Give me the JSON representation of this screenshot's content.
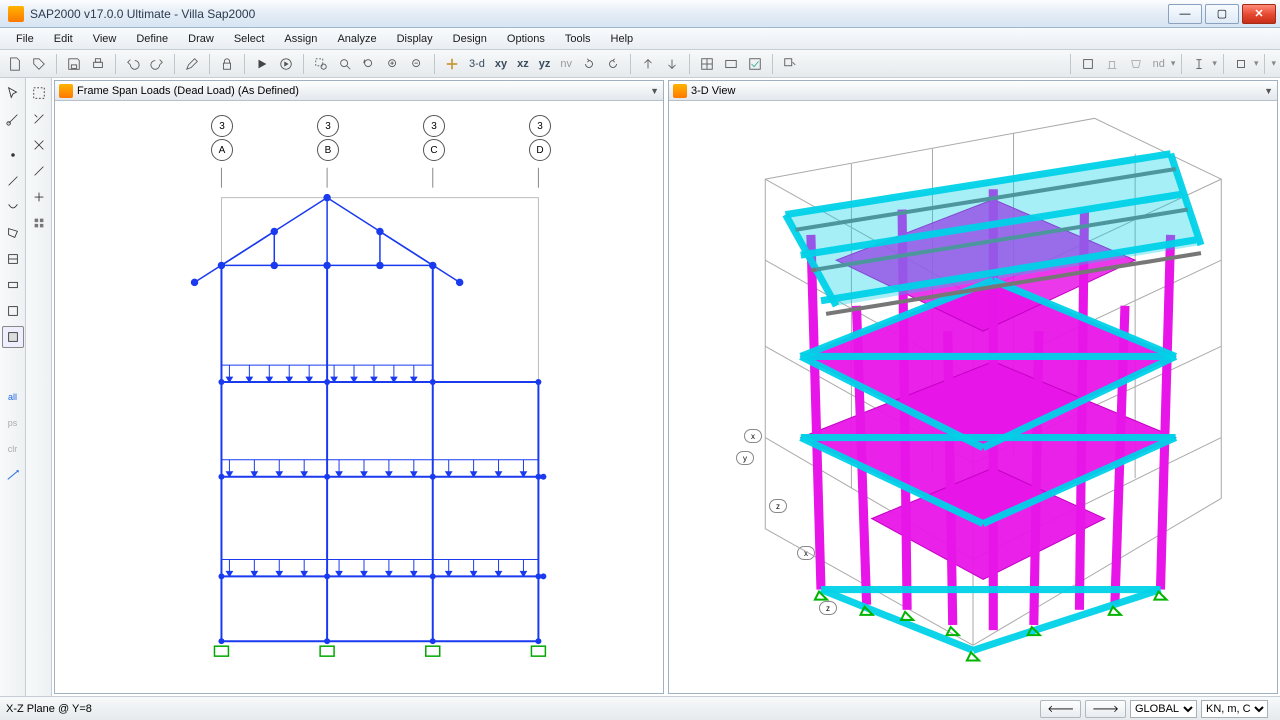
{
  "app": {
    "title": "SAP2000 v17.0.0 Ultimate  -  Villa Sap2000"
  },
  "menu": [
    "File",
    "Edit",
    "View",
    "Define",
    "Draw",
    "Select",
    "Assign",
    "Analyze",
    "Display",
    "Design",
    "Options",
    "Tools",
    "Help"
  ],
  "toolbar_text": {
    "td": "3-d",
    "xy": "xy",
    "xz": "xz",
    "yz": "yz",
    "nv": "nv",
    "nd": "nd"
  },
  "panes": {
    "left": {
      "title": "Frame Span Loads (Dead Load) (As Defined)"
    },
    "right": {
      "title": "3-D View"
    }
  },
  "grid_top": [
    "3",
    "3",
    "3",
    "3"
  ],
  "grid_letters": [
    "A",
    "B",
    "C",
    "D"
  ],
  "axis_callouts": [
    "x",
    "y",
    "z",
    "x",
    "z"
  ],
  "status": {
    "left": "X-Z Plane @ Y=8",
    "global": "GLOBAL",
    "units": "KN, m, C"
  }
}
